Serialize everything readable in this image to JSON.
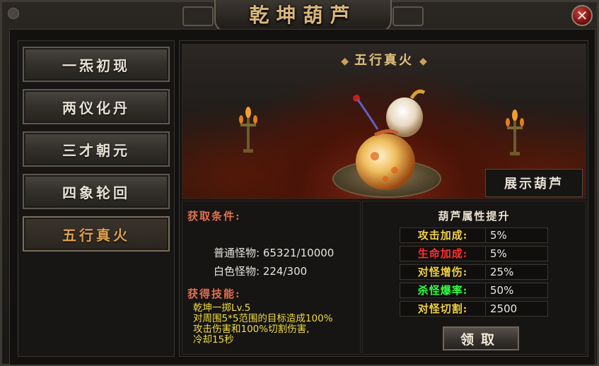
{
  "window": {
    "title": "乾坤葫芦",
    "close_label": "✕"
  },
  "nav": {
    "items": [
      {
        "label": "一炁初现",
        "active": false
      },
      {
        "label": "两仪化丹",
        "active": false
      },
      {
        "label": "三才朝元",
        "active": false
      },
      {
        "label": "四象轮回",
        "active": false
      },
      {
        "label": "五行真火",
        "active": true
      }
    ]
  },
  "scene": {
    "title": "五行真火",
    "show_label": "展示葫芦"
  },
  "conditions": {
    "header": "获取条件:",
    "rows": [
      {
        "label": "普通怪物:",
        "value": "65321/10000"
      },
      {
        "label": "白色怪物:",
        "value": "224/300"
      }
    ]
  },
  "skill": {
    "header": "获得技能:",
    "lines": [
      "乾坤一掷Lv.5",
      "对周围5*5范围的目标造成100%",
      "攻击伤害和100%切割伤害,",
      "冷却15秒"
    ]
  },
  "attributes": {
    "title": "葫芦属性提升",
    "rows": [
      {
        "label": "攻击加成:",
        "value": "5%",
        "color": "#f0d040"
      },
      {
        "label": "生命加成:",
        "value": "5%",
        "color": "#ff3030"
      },
      {
        "label": "对怪增伤:",
        "value": "25%",
        "color": "#f0d040"
      },
      {
        "label": "杀怪爆率:",
        "value": "50%",
        "color": "#30ff40"
      },
      {
        "label": "对怪切割:",
        "value": "2500",
        "color": "#f0d040"
      }
    ],
    "claim_label": "领取"
  }
}
